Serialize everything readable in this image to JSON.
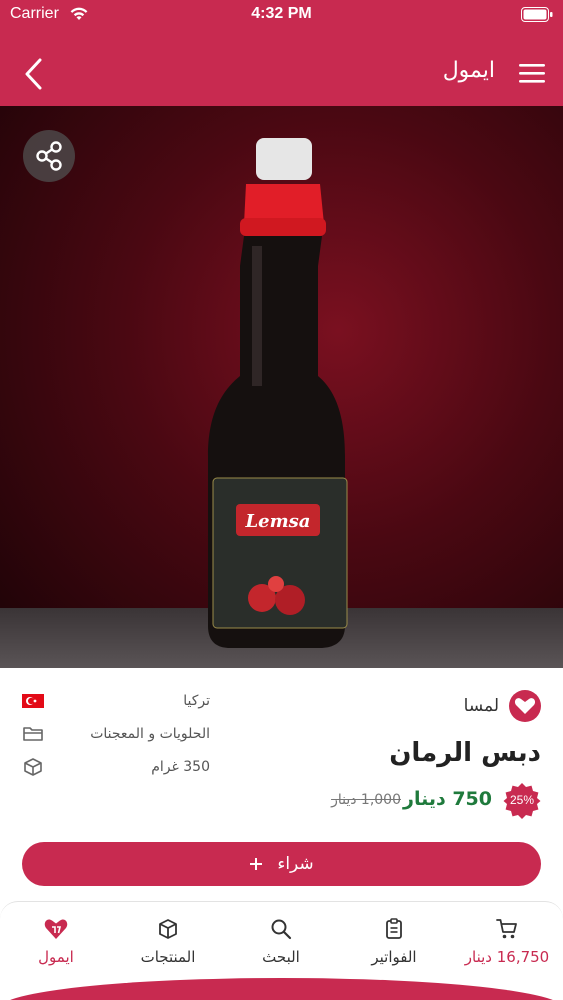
{
  "status_bar": {
    "carrier": "Carrier",
    "time": "4:32 PM"
  },
  "nav": {
    "title": "ايمول",
    "back_icon": "chevron-left-icon",
    "menu_icon": "hamburger-menu-icon"
  },
  "hero": {
    "share_icon": "share-icon"
  },
  "product": {
    "brand": "لمسا",
    "name": "دبس الرمان",
    "origin": "تركيا",
    "category": "الحلويات و المعجنات",
    "size": "350 غرام",
    "discount": "25%",
    "price": "750 دينار",
    "old_price": "1,000 دينار",
    "label_brand": "Lemsa"
  },
  "buy_button": {
    "label": "شراء",
    "icon": "plus-icon"
  },
  "tabbar": {
    "cart": "16,750 دينار",
    "invoices": "الفواتير",
    "search": "البحث",
    "products": "المنتجات",
    "home": "ايمول"
  },
  "colors": {
    "accent": "#c82a50",
    "price_green": "#1f7a3c"
  }
}
